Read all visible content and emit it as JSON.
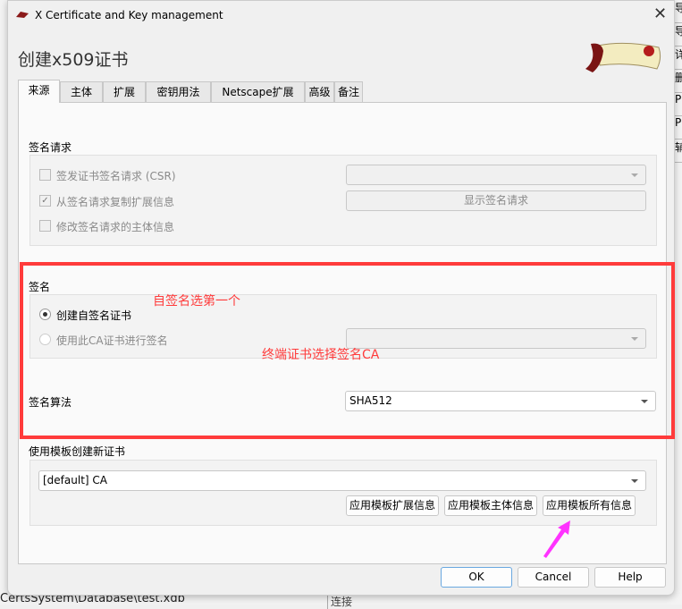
{
  "window": {
    "title": "X Certificate and Key management",
    "close_icon": "close-icon"
  },
  "background_app": {
    "side_fragments": [
      "导",
      "导",
      "详",
      "删",
      "PK",
      "P",
      "辅"
    ],
    "status_path": "CertsSystem\\Database\\test.xdb",
    "status_right": "连接"
  },
  "dialog": {
    "heading": "创建x509证书",
    "tabs": [
      {
        "label": "来源",
        "active": true
      },
      {
        "label": "主体"
      },
      {
        "label": "扩展"
      },
      {
        "label": "密钥用法"
      },
      {
        "label": "Netscape扩展"
      },
      {
        "label": "高级"
      },
      {
        "label": "备注"
      }
    ],
    "signing_request": {
      "title": "签名请求",
      "sign_csr": {
        "label": "签发证书签名请求 (CSR)",
        "checked": false,
        "enabled": false
      },
      "copy_ext": {
        "label": "从签名请求复制扩展信息",
        "checked": true,
        "enabled": false
      },
      "modify_subject": {
        "label": "修改签名请求的主体信息",
        "checked": false,
        "enabled": false
      },
      "csr_select": {
        "value": ""
      },
      "show_request_button": "显示签名请求"
    },
    "signing": {
      "title": "签名",
      "self_signed": {
        "label": "创建自签名证书",
        "selected": true
      },
      "use_ca": {
        "label": "使用此CA证书进行签名",
        "selected": false,
        "enabled": false
      },
      "ca_select": {
        "value": ""
      },
      "algorithm_label": "签名算法",
      "algorithm_value": "SHA512"
    },
    "template": {
      "title": "使用模板创建新证书",
      "value": "[default] CA",
      "apply_ext_button": "应用模板扩展信息",
      "apply_subject_button": "应用模板主体信息",
      "apply_all_button": "应用模板所有信息"
    },
    "buttons": {
      "ok": "OK",
      "cancel": "Cancel",
      "help": "Help"
    }
  },
  "annotations": {
    "note1": "自签名选第一个",
    "note2": "终端证书选择签名CA",
    "box_color": "#ff3b3b",
    "arrow_color": "#ff33ff"
  }
}
